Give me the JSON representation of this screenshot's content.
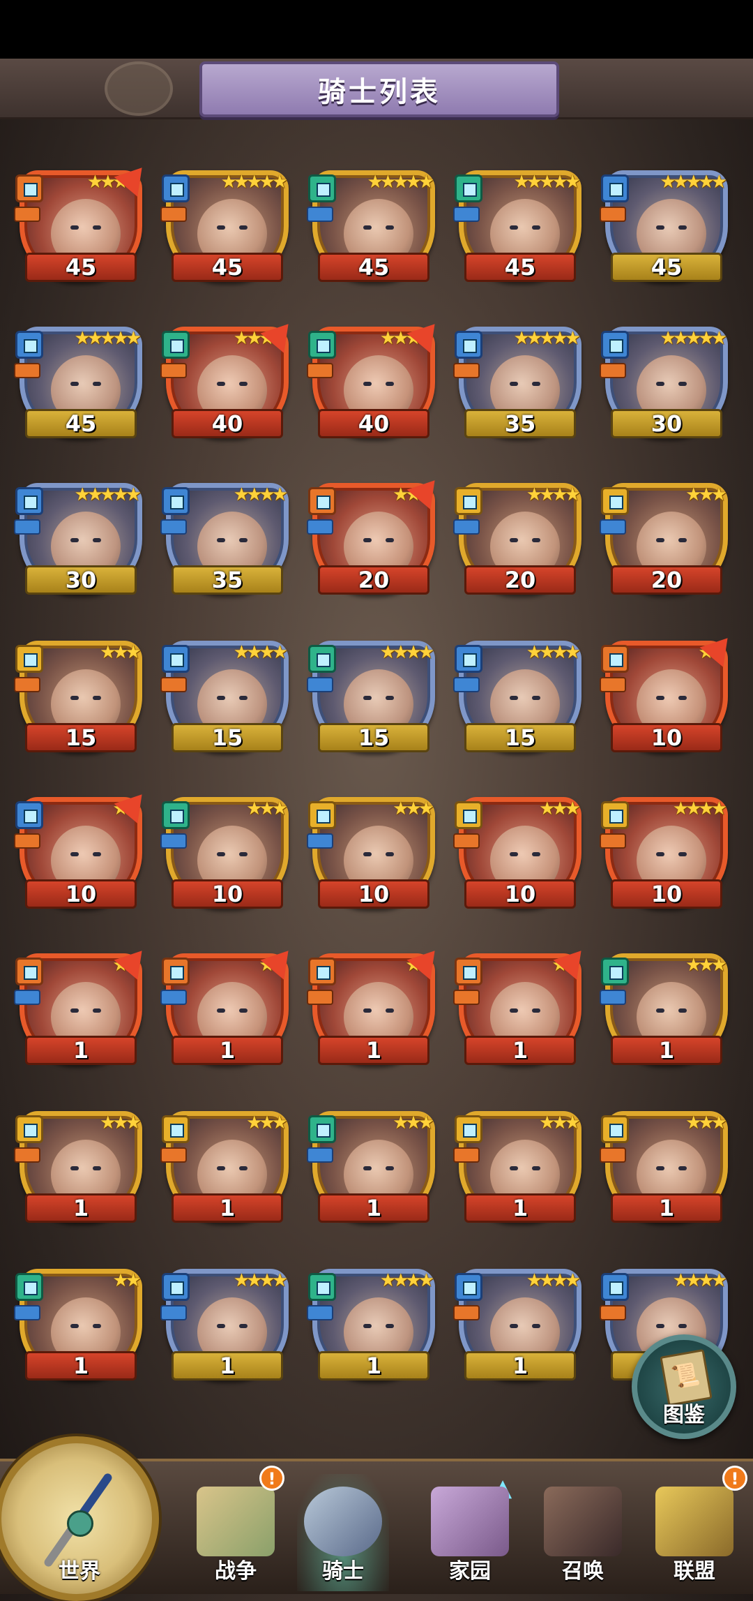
{
  "header": {
    "title": "骑士列表"
  },
  "knights": [
    {
      "level": "45",
      "stars": "★★★★",
      "frame": "red",
      "badge": "orange",
      "tag": "orange",
      "arrow": true
    },
    {
      "level": "45",
      "stars": "★★★★★",
      "frame": "gold",
      "badge": "blue",
      "tag": "orange",
      "arrow": false
    },
    {
      "level": "45",
      "stars": "★★★★★",
      "frame": "gold",
      "badge": "green",
      "tag": "blue",
      "arrow": false
    },
    {
      "level": "45",
      "stars": "★★★★★",
      "frame": "gold",
      "badge": "green",
      "tag": "blue",
      "arrow": false
    },
    {
      "level": "45",
      "stars": "★★★★★",
      "frame": "blue",
      "badge": "blue",
      "tag": "orange",
      "arrow": false
    },
    {
      "level": "45",
      "stars": "★★★★★",
      "frame": "blue",
      "badge": "blue",
      "tag": "orange",
      "arrow": false
    },
    {
      "level": "40",
      "stars": "★★★★",
      "frame": "red",
      "badge": "green",
      "tag": "orange",
      "arrow": true
    },
    {
      "level": "40",
      "stars": "★★★★",
      "frame": "red",
      "badge": "green",
      "tag": "orange",
      "arrow": true
    },
    {
      "level": "35",
      "stars": "★★★★★",
      "frame": "blue",
      "badge": "blue",
      "tag": "orange",
      "arrow": false
    },
    {
      "level": "30",
      "stars": "★★★★★",
      "frame": "blue",
      "badge": "blue",
      "tag": "orange",
      "arrow": false
    },
    {
      "level": "30",
      "stars": "★★★★★",
      "frame": "blue",
      "badge": "blue",
      "tag": "blue",
      "arrow": false
    },
    {
      "level": "35",
      "stars": "★★★★",
      "frame": "blue",
      "badge": "blue",
      "tag": "blue",
      "arrow": false
    },
    {
      "level": "20",
      "stars": "★★★",
      "frame": "red",
      "badge": "orange",
      "tag": "blue",
      "arrow": true
    },
    {
      "level": "20",
      "stars": "★★★★",
      "frame": "gold",
      "badge": "gold",
      "tag": "blue",
      "arrow": false
    },
    {
      "level": "20",
      "stars": "★★★",
      "frame": "gold",
      "badge": "gold",
      "tag": "blue",
      "arrow": false
    },
    {
      "level": "15",
      "stars": "★★★",
      "frame": "gold",
      "badge": "gold",
      "tag": "orange",
      "arrow": false
    },
    {
      "level": "15",
      "stars": "★★★★",
      "frame": "blue",
      "badge": "blue",
      "tag": "orange",
      "arrow": false
    },
    {
      "level": "15",
      "stars": "★★★★",
      "frame": "blue",
      "badge": "green",
      "tag": "blue",
      "arrow": false
    },
    {
      "level": "15",
      "stars": "★★★★",
      "frame": "blue",
      "badge": "blue",
      "tag": "blue",
      "arrow": false
    },
    {
      "level": "10",
      "stars": "★★",
      "frame": "red",
      "badge": "orange",
      "tag": "orange",
      "arrow": true
    },
    {
      "level": "10",
      "stars": "★★",
      "frame": "red",
      "badge": "blue",
      "tag": "orange",
      "arrow": true
    },
    {
      "level": "10",
      "stars": "★★★",
      "frame": "gold",
      "badge": "green",
      "tag": "blue",
      "arrow": false
    },
    {
      "level": "10",
      "stars": "★★★",
      "frame": "gold",
      "badge": "gold",
      "tag": "blue",
      "arrow": false
    },
    {
      "level": "10",
      "stars": "★★★",
      "frame": "red",
      "badge": "gold",
      "tag": "orange",
      "arrow": false
    },
    {
      "level": "10",
      "stars": "★★★★",
      "frame": "red",
      "badge": "gold",
      "tag": "orange",
      "arrow": false
    },
    {
      "level": "1",
      "stars": "★★",
      "frame": "red",
      "badge": "orange",
      "tag": "blue",
      "arrow": true
    },
    {
      "level": "1",
      "stars": "★★",
      "frame": "red",
      "badge": "orange",
      "tag": "blue",
      "arrow": true
    },
    {
      "level": "1",
      "stars": "★★",
      "frame": "red",
      "badge": "orange",
      "tag": "orange",
      "arrow": true
    },
    {
      "level": "1",
      "stars": "★★",
      "frame": "red",
      "badge": "orange",
      "tag": "orange",
      "arrow": true
    },
    {
      "level": "1",
      "stars": "★★★",
      "frame": "gold",
      "badge": "green",
      "tag": "blue",
      "arrow": false
    },
    {
      "level": "1",
      "stars": "★★★",
      "frame": "gold",
      "badge": "gold",
      "tag": "orange",
      "arrow": false
    },
    {
      "level": "1",
      "stars": "★★★",
      "frame": "gold",
      "badge": "gold",
      "tag": "orange",
      "arrow": false
    },
    {
      "level": "1",
      "stars": "★★★",
      "frame": "gold",
      "badge": "green",
      "tag": "blue",
      "arrow": false
    },
    {
      "level": "1",
      "stars": "★★★",
      "frame": "gold",
      "badge": "gold",
      "tag": "orange",
      "arrow": false
    },
    {
      "level": "1",
      "stars": "★★★",
      "frame": "gold",
      "badge": "gold",
      "tag": "orange",
      "arrow": false
    },
    {
      "level": "1",
      "stars": "★★",
      "frame": "gold",
      "badge": "green",
      "tag": "blue",
      "arrow": false
    },
    {
      "level": "1",
      "stars": "★★★★",
      "frame": "blue",
      "badge": "blue",
      "tag": "blue",
      "arrow": false
    },
    {
      "level": "1",
      "stars": "★★★★",
      "frame": "blue",
      "badge": "green",
      "tag": "blue",
      "arrow": false
    },
    {
      "level": "1",
      "stars": "★★★★",
      "frame": "blue",
      "badge": "blue",
      "tag": "orange",
      "arrow": false
    },
    {
      "level": "1",
      "stars": "★★★★",
      "frame": "blue",
      "badge": "blue",
      "tag": "orange",
      "arrow": false
    }
  ],
  "atlas": {
    "label": "图鉴",
    "icon": "book-icon"
  },
  "nav": {
    "world": "世界",
    "war": "战争",
    "knight": "骑士",
    "home": "家园",
    "summon": "召唤",
    "alliance": "联盟",
    "alert_mark": "!"
  }
}
